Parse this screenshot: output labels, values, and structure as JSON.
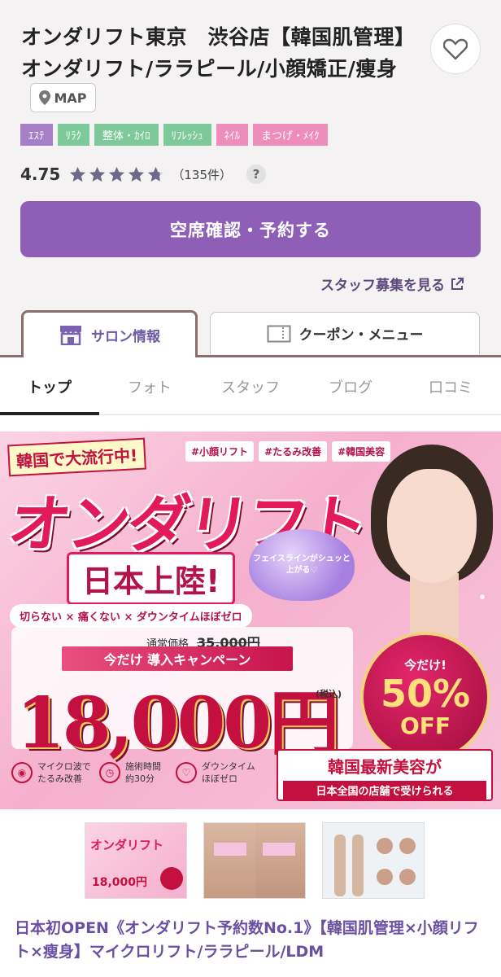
{
  "salon": {
    "title": "オンダリフト東京　渋谷店【韓国肌管理】オンダリフト/ララピール/小顔矯正/痩身",
    "map_label": "MAP",
    "tags": [
      {
        "label": "ｴｽﾃ",
        "color": "#a77fc9"
      },
      {
        "label": "ﾘﾗｸ",
        "color": "#7ec99a"
      },
      {
        "label": "整体・ｶｲﾛ",
        "color": "#7ec99a"
      },
      {
        "label": "ﾘﾌﾚｯｼｭ",
        "color": "#7ec99a"
      },
      {
        "label": "ﾈｲﾙ",
        "color": "#ee8db9"
      },
      {
        "label": "まつげ・ﾒｲｸ",
        "color": "#ee8db9"
      }
    ],
    "rating": "4.75",
    "rating_stars": 4.75,
    "review_count": "（135件）",
    "help_label": "?",
    "reserve_label": "空席確認・予約する",
    "staff_link_label": "スタッフ募集を見る"
  },
  "tabs": {
    "salon_info": "サロン情報",
    "coupon_menu": "クーポン・メニュー"
  },
  "subnav": {
    "items": [
      "トップ",
      "フォト",
      "スタッフ",
      "ブログ",
      "口コミ"
    ]
  },
  "banner": {
    "trend": "韓国で大流行中!",
    "hashtags": [
      "#小顔リフト",
      "#たるみ改善",
      "#韓国美容"
    ],
    "headline": "オンダリフト",
    "landing": "日本上陸!",
    "heart_text": "フェイスラインがシュッと上がる♡",
    "points": "切らない × 痛くない × ダウンタイムほぼゼロ",
    "regular_label": "通常価格",
    "regular_price": "35,000円",
    "campaign": "今だけ 導入キャンペーン",
    "price": "18,000円",
    "tax": "(税込)",
    "off_now": "今だけ!",
    "off_pct": "50%",
    "off_label": "OFF",
    "features": [
      {
        "icon": "((•))",
        "text": "マイクロ波で たるみ改善"
      },
      {
        "icon": "◷",
        "text": "施術時間 約30分"
      },
      {
        "icon": "♡",
        "text": "ダウンタイム ほぼゼロ"
      }
    ],
    "korea_line1": "韓国最新美容が",
    "korea_line2": "日本全国の店舗で受けられる"
  },
  "thumbs": {
    "t1_title": "オンダリフト",
    "t1_price": "18,000円"
  },
  "description": "日本初OPEN《オンダリフト予約数No.1》【韓国肌管理×小顔リフト×瘦身】マイクロリフト/ララピール/LDM",
  "colors": {
    "brand_purple": "#8f5fb8",
    "accent_pink": "#e21a5a",
    "star_color": "#6e6a8a"
  }
}
